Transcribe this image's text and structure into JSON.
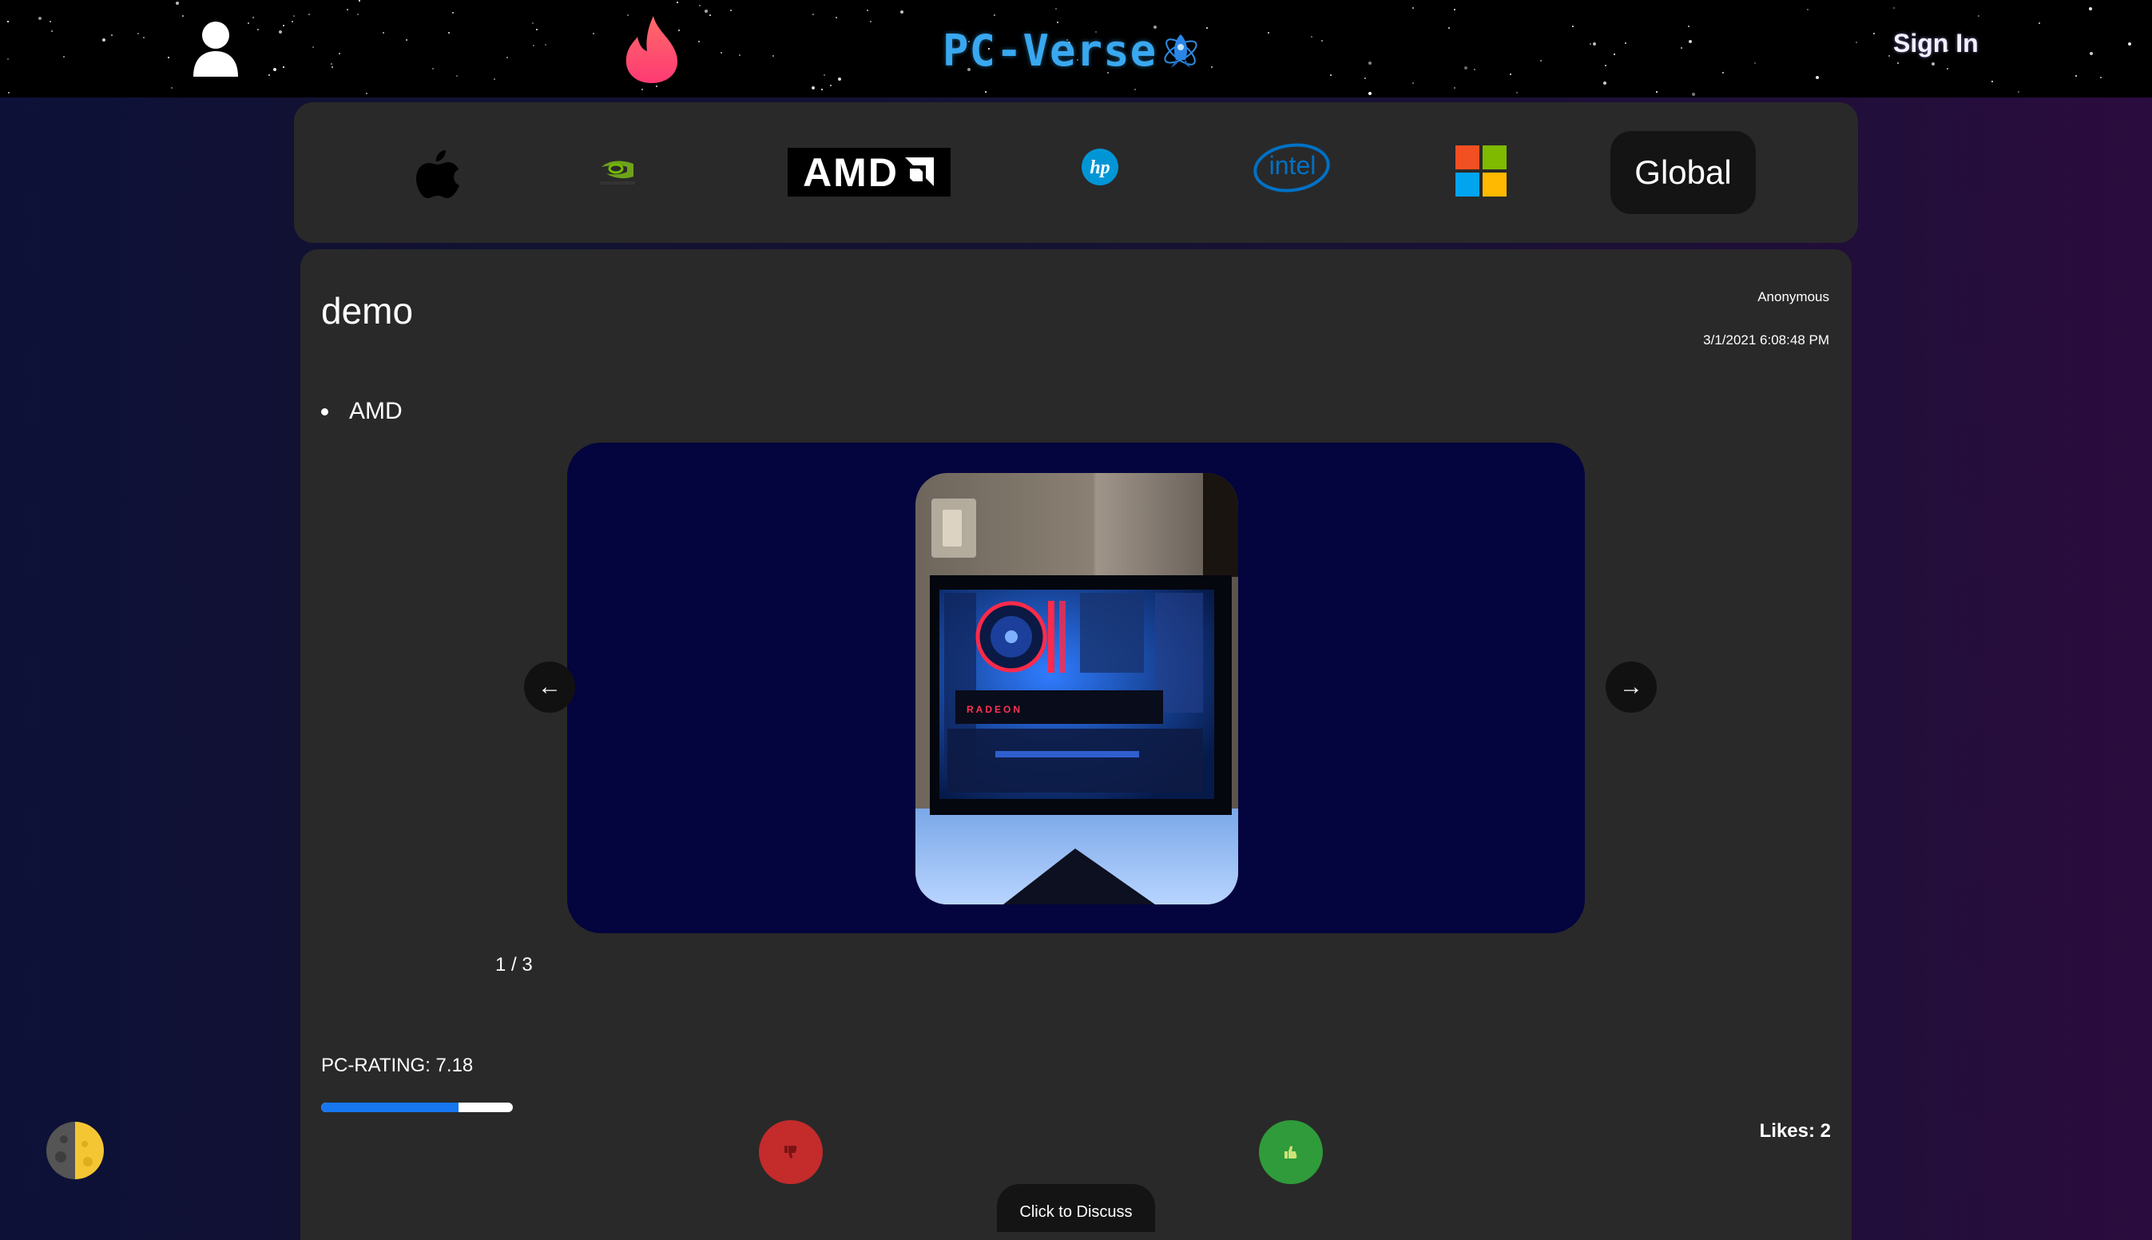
{
  "header": {
    "brand": "PC-Verse",
    "sign_in": "Sign In",
    "icons": [
      "user-icon",
      "fire-icon",
      "atom-rocket-icon"
    ]
  },
  "brand_filter": {
    "items": [
      {
        "name": "apple",
        "icon": "apple-logo"
      },
      {
        "name": "nvidia",
        "icon": "nvidia-logo"
      },
      {
        "name": "amd",
        "label": "AMD",
        "icon": "amd-logo"
      },
      {
        "name": "hp",
        "label": "hp",
        "icon": "hp-logo"
      },
      {
        "name": "intel",
        "label": "intel",
        "icon": "intel-logo"
      },
      {
        "name": "microsoft",
        "icon": "microsoft-logo"
      }
    ],
    "global_label": "Global"
  },
  "post": {
    "title": "demo",
    "author": "Anonymous",
    "date": "3/1/2021 6:08:48 PM",
    "tags": [
      "AMD"
    ],
    "carousel": {
      "counter": "1 / 3",
      "prev": "←",
      "next": "→",
      "current_index": 1,
      "total": 3
    },
    "rating_label": "PC-RATING: 7.18",
    "rating_value": 7.18,
    "rating_max": 10,
    "likes_label": "Likes: 2",
    "discuss_label": "Click to Discuss"
  },
  "colors": {
    "accent": "#1677f0",
    "brand_text": "#39a8f0",
    "dislike": "#c42b2b",
    "like": "#2f9b3a",
    "card": "#292929",
    "carousel_bg": "#04043e"
  }
}
